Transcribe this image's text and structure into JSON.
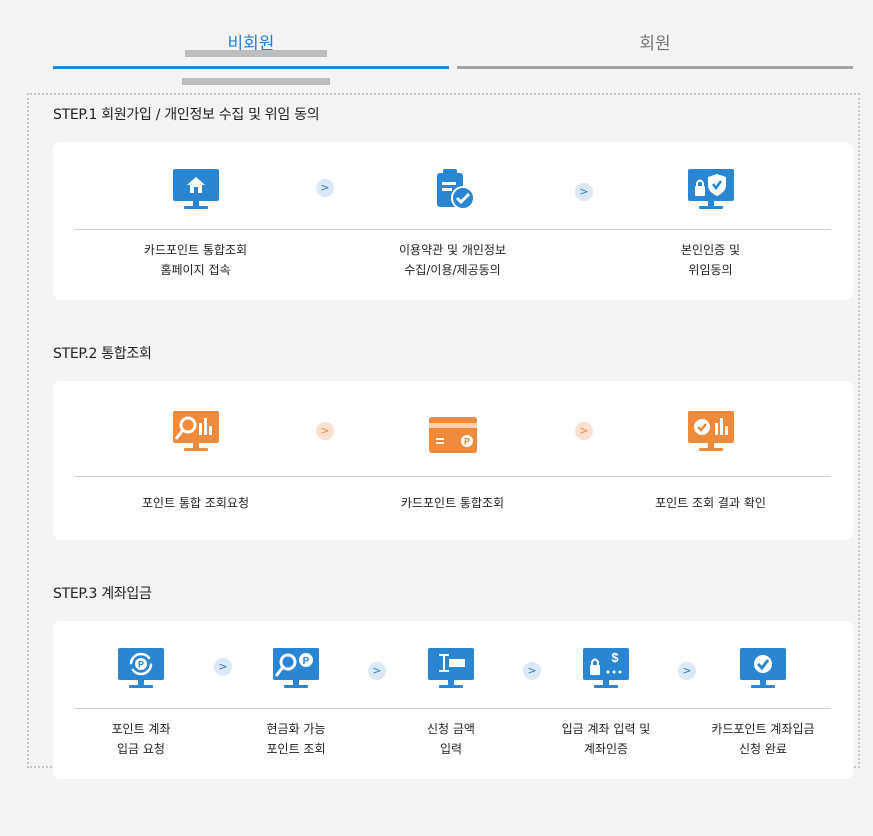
{
  "tabs": {
    "active_label": "비회원",
    "inactive_label": "회원"
  },
  "steps": [
    {
      "title": "STEP.1 회원가입 / 개인정보 수집 및 위임 동의",
      "items": [
        {
          "label": "카드포인트 통합조회\n홈페이지 접속",
          "icon": "home-monitor-icon"
        },
        {
          "label": "이용약관 및 개인정보\n수집/이용/제공동의",
          "icon": "clipboard-check-icon"
        },
        {
          "label": "본인인증 및\n위임동의",
          "icon": "lock-shield-monitor-icon"
        }
      ]
    },
    {
      "title": "STEP.2 통합조회",
      "items": [
        {
          "label": "포인트 통합 조회요청",
          "icon": "search-chart-monitor-icon"
        },
        {
          "label": "카드포인트 통합조회",
          "icon": "point-card-icon"
        },
        {
          "label": "포인트 조회 결과 확인",
          "icon": "check-chart-monitor-icon"
        }
      ]
    },
    {
      "title": "STEP.3 계좌입금",
      "items": [
        {
          "label": "포인트 계좌\n입금 요청",
          "icon": "point-refresh-monitor-icon"
        },
        {
          "label": "현금화 가능\n포인트 조회",
          "icon": "search-point-monitor-icon"
        },
        {
          "label": "신청 금액\n입력",
          "icon": "input-cursor-monitor-icon"
        },
        {
          "label": "입금 계좌 입력 및\n계좌인증",
          "icon": "lock-dollar-monitor-icon"
        },
        {
          "label": "카드포인트 계좌입금\n신청 완료",
          "icon": "check-monitor-icon"
        }
      ]
    }
  ],
  "colors": {
    "accent_blue": "#2a86d2",
    "accent_orange": "#ef8a3c",
    "inactive_gray": "#a3a3a3"
  }
}
